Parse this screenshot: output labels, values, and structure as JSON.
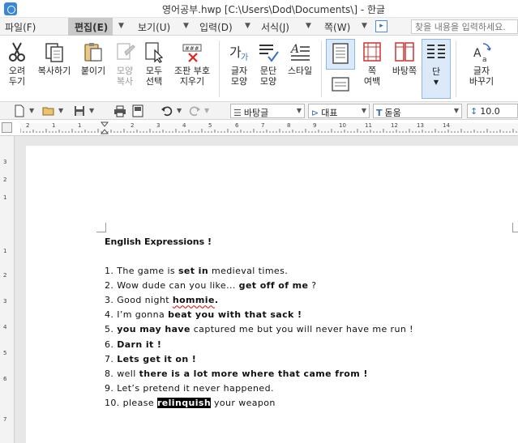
{
  "window": {
    "title": "영어공부.hwp [C:\\Users\\Dod\\Documents\\] - 한글"
  },
  "menu": {
    "items": [
      "파일(F)",
      "편집(E)",
      "보기(U)",
      "입력(D)",
      "서식(J)",
      "쪽(W)"
    ],
    "search_placeholder": "찾을 내용을 입력하세요."
  },
  "ribbon": {
    "buttons": [
      {
        "label": "오려\n두기",
        "icon": "scissors-icon"
      },
      {
        "label": "복사하기",
        "icon": "copy-icon"
      },
      {
        "label": "붙이기",
        "icon": "paste-icon"
      },
      {
        "label": "모양\n복사",
        "icon": "format-painter-icon"
      },
      {
        "label": "모두\n선택",
        "icon": "select-all-icon"
      },
      {
        "label": "조판 부호\n지우기",
        "icon": "clear-codes-icon"
      },
      {
        "label": "글자\n모양",
        "icon": "char-shape-icon"
      },
      {
        "label": "문단\n모양",
        "icon": "paragraph-shape-icon"
      },
      {
        "label": "스타일",
        "icon": "style-icon"
      },
      {
        "label": "쪽\n여백",
        "icon": "page-margin-icon"
      },
      {
        "label": "바탕쪽",
        "icon": "master-page-icon"
      },
      {
        "label": "단",
        "icon": "columns-icon"
      },
      {
        "label": "글자\n바꾸기",
        "icon": "replace-char-icon"
      }
    ]
  },
  "format_bar": {
    "style": "바탕글",
    "lang": "대표",
    "font": "돋움",
    "size": "10.0"
  },
  "ruler": {
    "numbers": [
      "2",
      "1",
      "1",
      "2",
      "3",
      "4",
      "5",
      "6",
      "7",
      "8",
      "9",
      "10",
      "11",
      "12",
      "13",
      "14"
    ]
  },
  "vruler": {
    "numbers": [
      "3",
      "2",
      "1",
      "1",
      "2",
      "3",
      "4",
      "5",
      "6",
      "7"
    ]
  },
  "document": {
    "title": "English Expressions !",
    "lines": [
      {
        "num": "1.",
        "parts": [
          [
            "n",
            "The game is "
          ],
          [
            "b",
            "set in"
          ],
          [
            "n",
            " medieval times."
          ]
        ]
      },
      {
        "num": "2.",
        "parts": [
          [
            "n",
            "Wow dude can you like... "
          ],
          [
            "b",
            "get off of me"
          ],
          [
            "n",
            " ?"
          ]
        ]
      },
      {
        "num": "3.",
        "parts": [
          [
            "n",
            "Good night "
          ],
          [
            "s",
            "hommie"
          ],
          [
            "b",
            "."
          ]
        ]
      },
      {
        "num": "4.",
        "parts": [
          [
            "n",
            "I’m gonna "
          ],
          [
            "b",
            "beat you with that sack !"
          ]
        ]
      },
      {
        "num": "5.",
        "parts": [
          [
            "b",
            "you may have"
          ],
          [
            "n",
            " captured me but you will never have me run !"
          ]
        ]
      },
      {
        "num": "6.",
        "parts": [
          [
            "b",
            "Darn it !"
          ]
        ]
      },
      {
        "num": "7.",
        "parts": [
          [
            "b",
            "Lets get it on !"
          ]
        ]
      },
      {
        "num": "8.",
        "parts": [
          [
            "n",
            "well "
          ],
          [
            "b",
            "there is a lot more where that came from !"
          ]
        ]
      },
      {
        "num": "9.",
        "parts": [
          [
            "n",
            "Let’s pretend it never happened."
          ]
        ]
      },
      {
        "num": "10.",
        "parts": [
          [
            "n",
            "please "
          ],
          [
            "h",
            "relinquish"
          ],
          [
            "n",
            " your weapon"
          ]
        ]
      }
    ]
  }
}
